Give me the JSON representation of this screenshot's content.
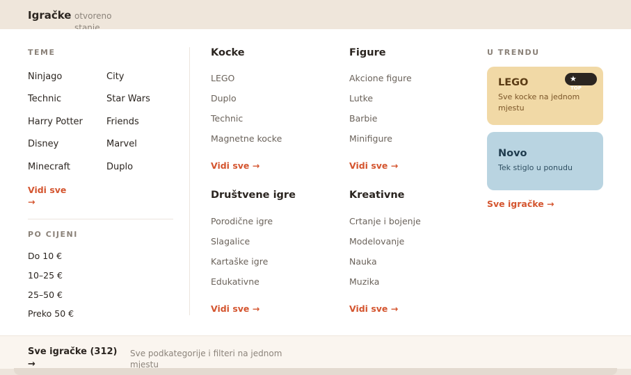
{
  "header": {
    "brand": "Igračke",
    "state": "otvoreno stanje"
  },
  "themes": {
    "title": "TEME",
    "items": [
      "Ninjago",
      "City",
      "Technic",
      "Star Wars",
      "Harry Potter",
      "Friends",
      "Disney",
      "Marvel",
      "Minecraft",
      "Duplo"
    ],
    "see_all": "Vidi sve",
    "see_all_arrow": "→"
  },
  "price": {
    "title": "PO CIJENI",
    "items": [
      "Do 10 €",
      "10–25 €",
      "25–50 €",
      "Preko 50 €"
    ]
  },
  "categories": [
    {
      "title": "Kocke",
      "links": [
        "LEGO",
        "Duplo",
        "Technic",
        "Magnetne kocke"
      ],
      "more": "Vidi sve →"
    },
    {
      "title": "Figure",
      "links": [
        "Akcione figure",
        "Lutke",
        "Barbie",
        "Minifigure"
      ],
      "more": "Vidi sve →"
    },
    {
      "title": "Društvene igre",
      "links": [
        "Porodične igre",
        "Slagalice",
        "Kartaške igre",
        "Edukativne"
      ],
      "more": "Vidi sve →"
    },
    {
      "title": "Kreativne",
      "links": [
        "Crtanje i bojenje",
        "Modelovanje",
        "Nauka",
        "Muzika"
      ],
      "more": "Vidi sve →"
    }
  ],
  "trending": {
    "title": "U TRENDU",
    "cards": [
      {
        "title": "LEGO",
        "subtitle": "Sve kocke na jednom mjestu",
        "badge": "TOP",
        "badge_icon": "star-icon",
        "color": "#f1d9a6",
        "text_color": "#5a3b14"
      },
      {
        "title": "Novo",
        "subtitle": "Tek stiglo u ponudu",
        "color": "#b9d4e1",
        "text_color": "#1f3b4d"
      }
    ],
    "all_link": "Sve igračke →"
  },
  "footer": {
    "all_label": "Sve igračke (312)",
    "all_arrow": "→",
    "note": "Sve podkategorije i filteri na jednom mjestu"
  },
  "colors": {
    "accent": "#d4552f",
    "background": "#ede5dc"
  }
}
